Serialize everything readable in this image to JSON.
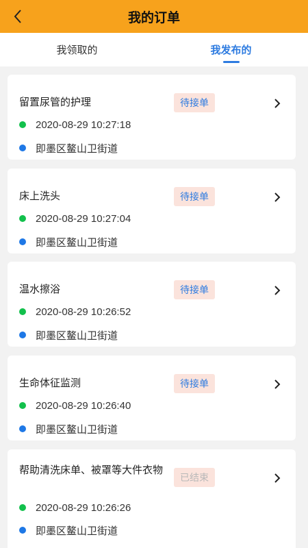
{
  "header": {
    "title": "我的订单",
    "back_icon": "chevron-left-icon"
  },
  "tabs": [
    {
      "label": "我领取的",
      "active": false
    },
    {
      "label": "我发布的",
      "active": true
    }
  ],
  "colors": {
    "accent": "#f7a21c",
    "tab_active": "#2d7be0",
    "badge_bg": "#fbe3dc",
    "dot_time": "#12c04c",
    "dot_location": "#1e78e6"
  },
  "orders": [
    {
      "title": "留置尿管的护理",
      "status": "待接单",
      "time": "2020-08-29 10:27:18",
      "location": "即墨区鳌山卫街道"
    },
    {
      "title": "床上洗头",
      "status": "待接单",
      "time": "2020-08-29 10:27:04",
      "location": "即墨区鳌山卫街道"
    },
    {
      "title": "温水擦浴",
      "status": "待接单",
      "time": "2020-08-29 10:26:52",
      "location": "即墨区鳌山卫街道"
    },
    {
      "title": "生命体征监测",
      "status": "待接单",
      "time": "2020-08-29 10:26:40",
      "location": "即墨区鳌山卫街道"
    },
    {
      "title": "帮助清洗床单、被罩等大件衣物",
      "status": "已结束",
      "time": "2020-08-29 10:26:26",
      "location": "即墨区鳌山卫街道"
    }
  ]
}
